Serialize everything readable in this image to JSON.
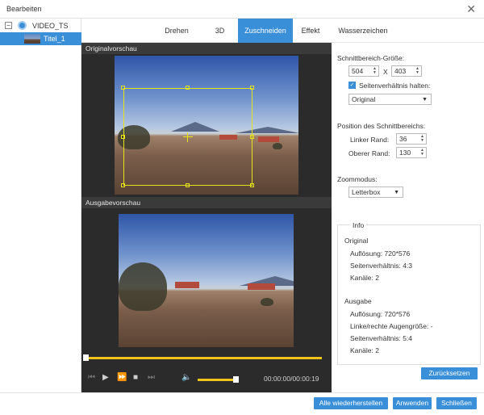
{
  "window": {
    "title": "Bearbeiten"
  },
  "tree": {
    "root_label": "VIDEO_TS",
    "child_label": "Titel_1"
  },
  "tabs": [
    {
      "label": "Drehen"
    },
    {
      "label": "3D"
    },
    {
      "label": "Zuschneiden"
    },
    {
      "label": "Effekt"
    },
    {
      "label": "Wasserzeichen"
    }
  ],
  "active_tab": "Zuschneiden",
  "preview": {
    "original_title": "Originalvorschau",
    "output_title": "Ausgabevorschau"
  },
  "player": {
    "timecode": "00:00:00/00:00:19",
    "seek_fraction": 0.0,
    "volume_fraction": 1.0
  },
  "crop": {
    "size_label": "Schnittbereich-Größe:",
    "width": "504",
    "height": "403",
    "x_sep": "X",
    "keep_ratio_label": "Seitenverhältnis halten:",
    "keep_ratio_checked": true,
    "ratio_value": "Original",
    "position_label": "Position des Schnittbereichs:",
    "left_label": "Linker Rand:",
    "left_value": "36",
    "top_label": "Oberer Rand:",
    "top_value": "130",
    "zoom_label": "Zoommodus:",
    "zoom_value": "Letterbox"
  },
  "info": {
    "title": "Info",
    "original_heading": "Original",
    "original_resolution": "Auflösung: 720*576",
    "original_aspect": "Seitenverhältnis: 4:3",
    "original_channels": "Kanäle: 2",
    "output_heading": "Ausgabe",
    "output_resolution": "Auflösung: 720*576",
    "output_eye": "Linke/rechte Augengröße: -",
    "output_aspect": "Seitenverhältnis: 5:4",
    "output_channels": "Kanäle: 2"
  },
  "buttons": {
    "reset": "Zurücksetzen",
    "restore_all": "Alle wiederherstellen",
    "apply": "Anwenden",
    "close": "Schließen"
  },
  "colors": {
    "accent": "#3a8fd9",
    "crop_frame": "#e6e31a",
    "seek": "#f0c419"
  }
}
